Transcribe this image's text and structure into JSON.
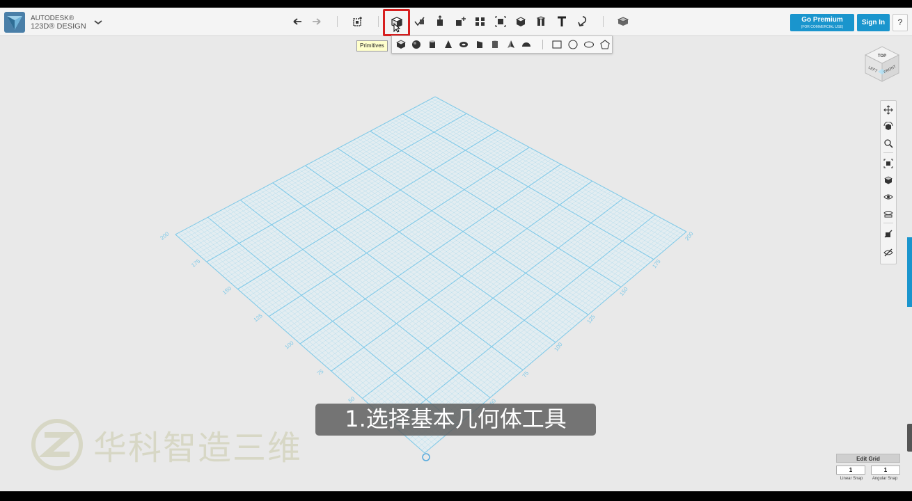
{
  "app": {
    "brand_line1": "AUTODESK®",
    "brand_line2": "123D® DESIGN"
  },
  "toolbar": {
    "tools": [
      {
        "name": "undo-icon"
      },
      {
        "name": "redo-icon"
      },
      {
        "name": "transform-icon"
      },
      {
        "name": "primitives-icon"
      },
      {
        "name": "sketch-icon"
      },
      {
        "name": "construct-icon"
      },
      {
        "name": "modify-icon"
      },
      {
        "name": "pattern-icon"
      },
      {
        "name": "group-icon"
      },
      {
        "name": "combine-icon"
      },
      {
        "name": "measure-icon"
      },
      {
        "name": "text-icon"
      },
      {
        "name": "snap-icon"
      },
      {
        "name": "material-icon"
      }
    ],
    "go_premium": "Go Premium",
    "go_premium_sub": "(FOR COMMERCIAL USE)",
    "sign_in": "Sign In",
    "help": "?"
  },
  "tooltip": "Primitives",
  "primitives_menu": [
    "box",
    "sphere",
    "cylinder",
    "cone",
    "torus",
    "wedge",
    "prism",
    "pyramid",
    "hemisphere",
    "rectangle",
    "circle",
    "ellipse",
    "polygon"
  ],
  "grid": {
    "left_ticks": [
      "200",
      "175",
      "150",
      "125",
      "100",
      "75",
      "50"
    ],
    "right_ticks": [
      "200",
      "175",
      "150",
      "125",
      "100",
      "75",
      "50"
    ]
  },
  "viewcube": {
    "top": "TOP",
    "left": "LEFT",
    "front": "FRONT"
  },
  "nav_tools": [
    "pan-icon",
    "orbit-icon",
    "zoom-icon",
    "fit-icon",
    "view-icon",
    "visibility-icon",
    "materials-display-icon",
    "snap-tool-icon",
    "hide-icon"
  ],
  "subtitle": "1.选择基本几何体工具",
  "watermark": "华科智造三维",
  "edit_grid": {
    "label": "Edit Grid",
    "linear_snap_value": "1",
    "angular_snap_value": "1",
    "linear_snap_label": "Linear Snap",
    "angular_snap_label": "Angular Snap"
  },
  "colors": {
    "accent": "#1a95cd",
    "grid": "#7cc8e8",
    "highlight": "#d71f1f"
  }
}
